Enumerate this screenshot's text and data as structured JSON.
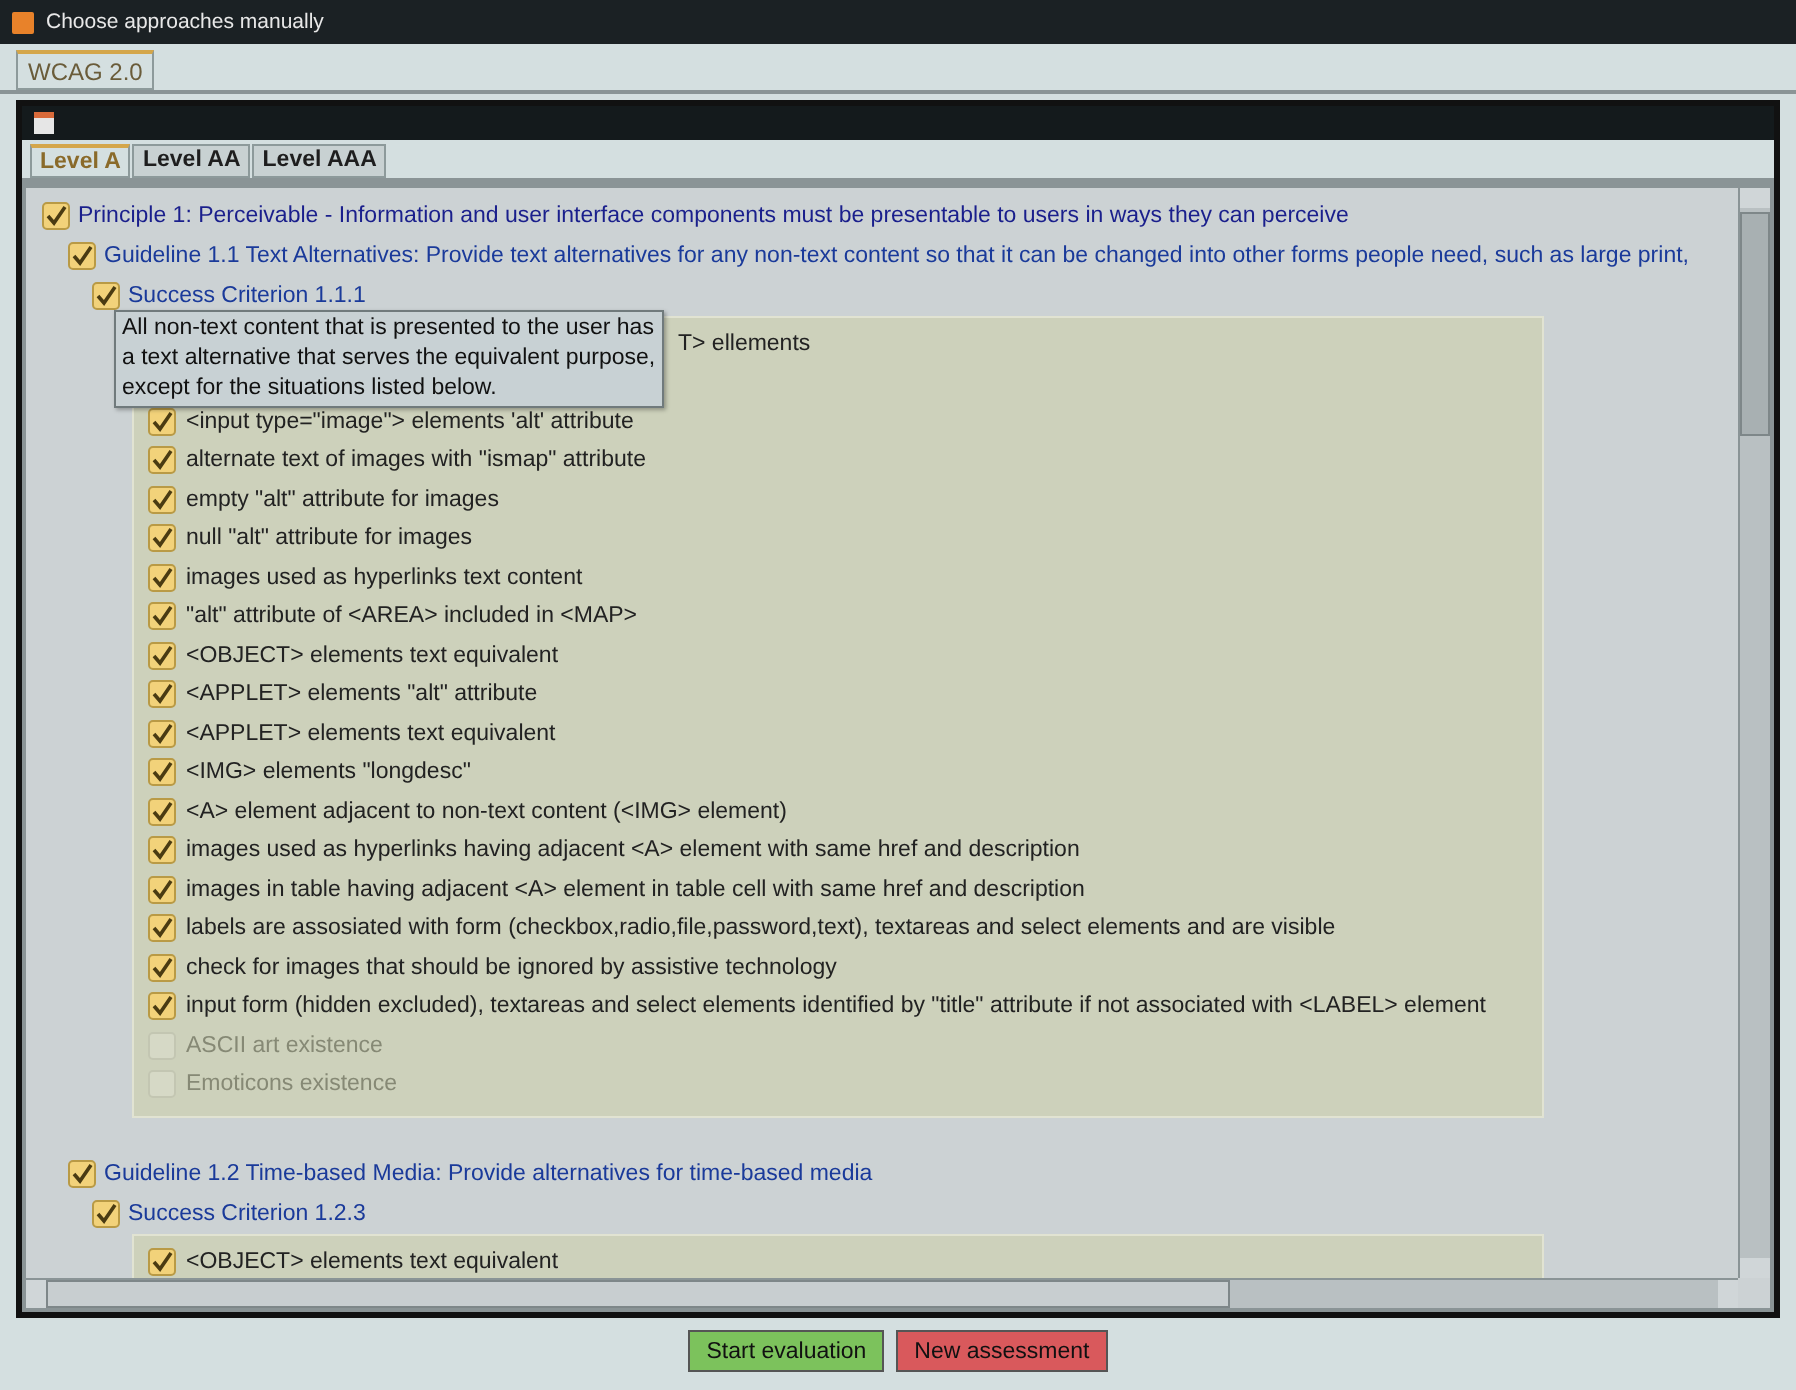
{
  "window": {
    "title": "Choose approaches manually"
  },
  "outer_tabs": [
    {
      "label": "WCAG 2.0",
      "selected": true
    }
  ],
  "level_tabs": [
    {
      "label": "Level A",
      "selected": true
    },
    {
      "label": "Level AA",
      "selected": false
    },
    {
      "label": "Level AAA",
      "selected": false
    }
  ],
  "tree": [
    {
      "label": "Principle 1: Perceivable - Information and user interface components must be presentable to users in ways they can perceive",
      "checked": true,
      "children": [
        {
          "label": "Guideline 1.1 Text Alternatives: Provide text alternatives for any non-text content so that it can be changed into other forms people need, such as large print,",
          "checked": true,
          "children": [
            {
              "label": "Success Criterion 1.1.1",
              "checked": true,
              "tooltip": "All non-text content that is presented to the user has\na text alternative that serves the equivalent purpose,\nexcept for the situations listed below.",
              "items": [
                {
                  "text": "T> ellements",
                  "kind": "covered"
                },
                {
                  "text": "<input type=\"image\"> elements 'alt' attribute",
                  "kind": "check",
                  "checked": true,
                  "disabled": false
                },
                {
                  "text": "alternate text of images with \"ismap\" attribute",
                  "kind": "check",
                  "checked": true,
                  "disabled": false
                },
                {
                  "text": "empty \"alt\" attribute for images",
                  "kind": "check",
                  "checked": true,
                  "disabled": false
                },
                {
                  "text": "null \"alt\" attribute for images",
                  "kind": "check",
                  "checked": true,
                  "disabled": false
                },
                {
                  "text": "images used as hyperlinks text content",
                  "kind": "check",
                  "checked": true,
                  "disabled": false
                },
                {
                  "text": "\"alt\" attribute of <AREA> included in <MAP>",
                  "kind": "check",
                  "checked": true,
                  "disabled": false
                },
                {
                  "text": "<OBJECT> elements text equivalent",
                  "kind": "check",
                  "checked": true,
                  "disabled": false
                },
                {
                  "text": "<APPLET> elements \"alt\" attribute",
                  "kind": "check",
                  "checked": true,
                  "disabled": false
                },
                {
                  "text": "<APPLET> elements text equivalent",
                  "kind": "check",
                  "checked": true,
                  "disabled": false
                },
                {
                  "text": "<IMG> elements \"longdesc\"",
                  "kind": "check",
                  "checked": true,
                  "disabled": false
                },
                {
                  "text": "<A> element adjacent to non-text content (<IMG> element)",
                  "kind": "check",
                  "checked": true,
                  "disabled": false
                },
                {
                  "text": "images used as hyperlinks having adjacent <A> element with same href and description",
                  "kind": "check",
                  "checked": true,
                  "disabled": false
                },
                {
                  "text": "images in table having adjacent <A> element in table cell with same href and description",
                  "kind": "check",
                  "checked": true,
                  "disabled": false
                },
                {
                  "text": "labels are assosiated with form (checkbox,radio,file,password,text), textareas and select elements and are visible",
                  "kind": "check",
                  "checked": true,
                  "disabled": false
                },
                {
                  "text": "check for images that should be ignored by assistive technology",
                  "kind": "check",
                  "checked": true,
                  "disabled": false
                },
                {
                  "text": "input form (hidden excluded), textareas and select elements identified by \"title\" attribute if not associated with <LABEL> element",
                  "kind": "check",
                  "checked": true,
                  "disabled": false
                },
                {
                  "text": "ASCII art existence",
                  "kind": "check",
                  "checked": false,
                  "disabled": true
                },
                {
                  "text": "Emoticons existence",
                  "kind": "check",
                  "checked": false,
                  "disabled": true
                }
              ]
            }
          ]
        },
        {
          "label": "Guideline 1.2 Time-based Media: Provide alternatives for time-based media",
          "checked": true,
          "children": [
            {
              "label": "Success Criterion 1.2.3",
              "checked": true,
              "items": [
                {
                  "text": "<OBJECT> elements text equivalent",
                  "kind": "check",
                  "checked": true,
                  "disabled": false
                }
              ]
            }
          ]
        }
      ]
    }
  ],
  "buttons": [
    {
      "label": "Start evaluation",
      "kind": "start"
    },
    {
      "label": "New assessment",
      "kind": "new"
    }
  ]
}
